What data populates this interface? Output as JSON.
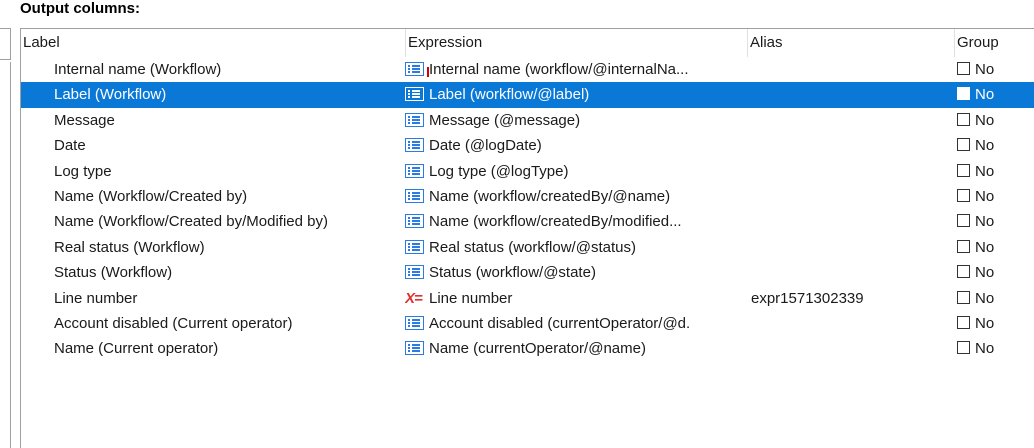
{
  "section_title": "Output columns:",
  "columns": {
    "label": "Label",
    "expression": "Expression",
    "alias": "Alias",
    "group": "Group"
  },
  "rows": [
    {
      "label": "Internal name (Workflow)",
      "expression": "Internal name (workflow/@internalNa...",
      "alias": "",
      "group": "No",
      "icon": "list-icon",
      "selected": false,
      "marker": true
    },
    {
      "label": "Label (Workflow)",
      "expression": "Label (workflow/@label)",
      "alias": "",
      "group": "No",
      "icon": "list-icon",
      "selected": true
    },
    {
      "label": "Message",
      "expression": "Message (@message)",
      "alias": "",
      "group": "No",
      "icon": "list-icon",
      "selected": false
    },
    {
      "label": "Date",
      "expression": "Date (@logDate)",
      "alias": "",
      "group": "No",
      "icon": "list-icon",
      "selected": false
    },
    {
      "label": "Log type",
      "expression": "Log type (@logType)",
      "alias": "",
      "group": "No",
      "icon": "list-icon",
      "selected": false
    },
    {
      "label": "Name (Workflow/Created by)",
      "expression": "Name (workflow/createdBy/@name)",
      "alias": "",
      "group": "No",
      "icon": "list-icon",
      "selected": false
    },
    {
      "label": "Name (Workflow/Created by/Modified by)",
      "expression": "Name (workflow/createdBy/modified...",
      "alias": "",
      "group": "No",
      "icon": "list-icon",
      "selected": false
    },
    {
      "label": "Real status (Workflow)",
      "expression": "Real status (workflow/@status)",
      "alias": "",
      "group": "No",
      "icon": "list-icon",
      "selected": false
    },
    {
      "label": "Status (Workflow)",
      "expression": "Status (workflow/@state)",
      "alias": "",
      "group": "No",
      "icon": "list-icon",
      "selected": false
    },
    {
      "label": "Line number",
      "expression": "Line number",
      "alias": "expr1571302339",
      "group": "No",
      "icon": "expression-icon",
      "icon_text": "X=",
      "selected": false
    },
    {
      "label": "Account disabled (Current operator)",
      "expression": "Account disabled (currentOperator/@d.",
      "alias": "",
      "group": "No",
      "icon": "list-icon",
      "selected": false
    },
    {
      "label": "Name (Current operator)",
      "expression": "Name (currentOperator/@name)",
      "alias": "",
      "group": "No",
      "icon": "list-icon",
      "selected": false
    }
  ],
  "colors": {
    "selection": "#0a78d7",
    "list_icon": "#2c7be5",
    "expression_icon": "#e0312f"
  }
}
